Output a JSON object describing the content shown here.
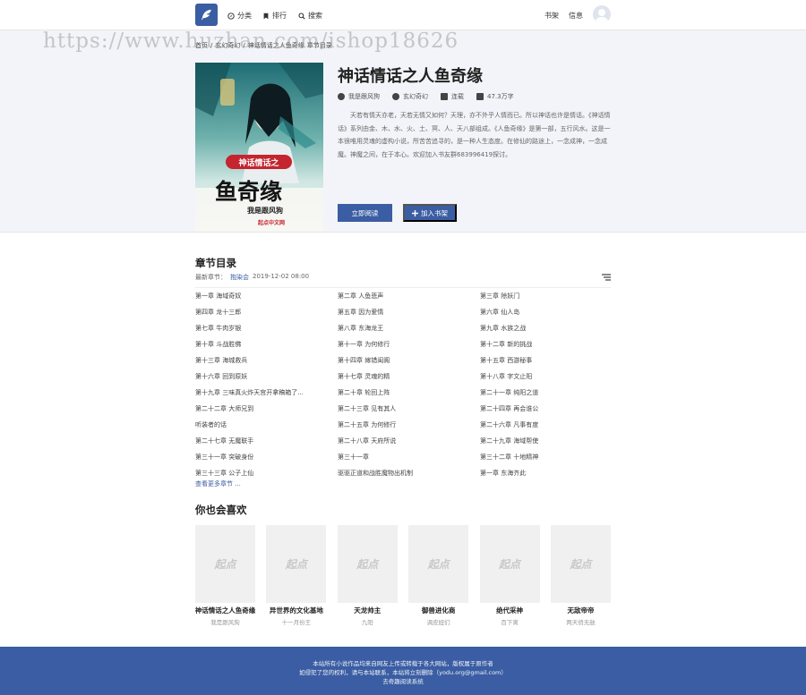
{
  "colors": {
    "accent": "#3a5da3",
    "hero_bg": "#f3f4f9",
    "footer_bg": "#3a5da3"
  },
  "header": {
    "logo_icon": "feather-icon",
    "nav": [
      {
        "label": "分类",
        "icon": "compass-icon"
      },
      {
        "label": "排行",
        "icon": "bookmark-icon"
      },
      {
        "label": "搜索",
        "icon": "search-icon"
      }
    ],
    "right": {
      "bookshelf": "书架",
      "messages": "信息"
    }
  },
  "watermark": "https://www.huzhan.com/ishop18626",
  "breadcrumb": {
    "home": "首页",
    "sep": "/",
    "category": "玄幻奇幻",
    "sep2": "/",
    "current": "神话情话之人鱼奇缘",
    "suffix": "章节目录"
  },
  "book": {
    "cover_title_top": "神话情话之",
    "cover_title_main": "鱼奇缘",
    "cover_author": "我是跟风狗",
    "cover_badge": "起点中文网",
    "title": "神话情话之人鱼奇缘",
    "author": "我是跟风狗",
    "genre": "玄幻奇幻",
    "status": "连载",
    "words": "47.3万字",
    "description": "天若有情天亦老，天若无情又如何？天理，亦不外乎人情而已。所以神话也许是情话。《神话情话》系列由金、木、水、火、土、冥、人、天八部组成。《人鱼奇缘》是第一部，五行风水。这是一本很唯用灵魂的虚构小说，所苦苦追寻的，是一种人生态度。在修仙的路途上，一念成神，一念成魔。神魔之间，在于本心。欢迎加入书友群683996419探讨。",
    "read_label": "立即阅读",
    "add_label": "加入书架"
  },
  "catalog": {
    "title": "章节目录",
    "latest_label": "最新章节：",
    "latest_chapter": "抱染会",
    "latest_time": "2019-12-02 08:00",
    "chapters": [
      "第一章 海域奇奴",
      "第二章 人鱼悲声",
      "第三章 除妖门",
      "第四章 龙十三郎",
      "第五章 因为爱情",
      "第六章 仙人岛",
      "第七章 牛肉岁银",
      "第八章 东海龙王",
      "第九章 水族之战",
      "第十章 斗战胜佛",
      "第十一章 为何修行",
      "第十二章 新的挑战",
      "第十三章 海城救兵",
      "第十四章 嫁错闺阁",
      "第十五章 西游秘事",
      "第十六章 回到原妖",
      "第十七章 灵魂的精",
      "第十八章 字文止阳",
      "第十九章 三味真火炸天宫开拿稿箱了...",
      "第二十章 轮回上阵",
      "第二十一章 纯阳之道",
      "第二十二章 大师兄到",
      "第二十三章 见有其人",
      "第二十四章 再会谁公",
      "听装者的话",
      "第二十五章 为何修行",
      "第二十六章 凡事有度",
      "第二十七章 无魔联手",
      "第二十八章 天府所说",
      "第二十九章 海域帮使",
      "第三十一章 突破身份",
      "第三十一章",
      "第三十二章 十地精神",
      "第三十三章 公子上仙",
      "驱驱正道和战胜魔物出机制",
      "第一章 东海齐此"
    ],
    "more": "查看更多章节 ..."
  },
  "recommend": {
    "title": "你也会喜欢",
    "items": [
      {
        "title": "神话情话之人鱼奇缘",
        "author": "我是跟风狗"
      },
      {
        "title": "异世界的文化基地",
        "author": "十一月份王"
      },
      {
        "title": "天龙帅主",
        "author": "九阳"
      },
      {
        "title": "御兽进化商",
        "author": "调皮妞们"
      },
      {
        "title": "绝代采神",
        "author": "百下离"
      },
      {
        "title": "无敌帝帝",
        "author": "两天俏无敌"
      }
    ],
    "placeholder_text": "起点"
  },
  "footer": {
    "line1": "本站所有小说作品均来自网友上传或转载于各大网站，版权属于原作者",
    "line2": "如侵犯了您的权利，请与本站联系，本站将立刻删除（yodu.org@gmail.com）",
    "line3": "去奇趣阅读系统"
  }
}
